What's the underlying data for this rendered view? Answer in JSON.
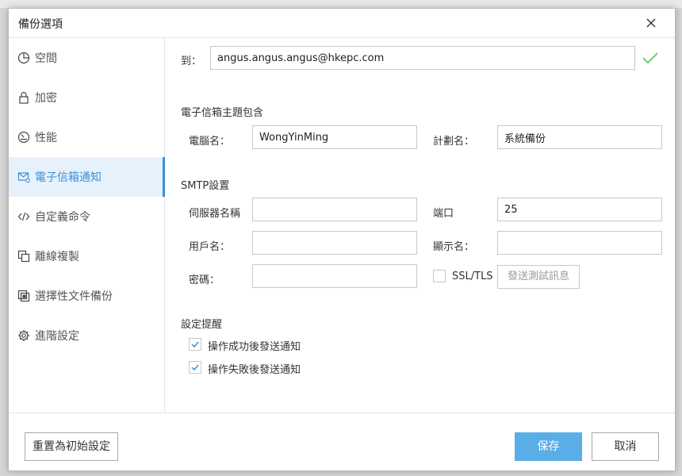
{
  "window": {
    "title": "備份選項",
    "close_icon": "close-icon"
  },
  "sidebar": {
    "items": [
      {
        "label": "空間",
        "icon": "pie-chart-icon"
      },
      {
        "label": "加密",
        "icon": "lock-icon"
      },
      {
        "label": "性能",
        "icon": "gauge-icon"
      },
      {
        "label": "電子信箱通知",
        "icon": "mail-icon",
        "active": true
      },
      {
        "label": "自定義命令",
        "icon": "code-icon"
      },
      {
        "label": "離線複製",
        "icon": "copy-icon"
      },
      {
        "label": "選擇性文件備份",
        "icon": "file-select-icon"
      },
      {
        "label": "進階設定",
        "icon": "gear-icon"
      }
    ]
  },
  "form": {
    "to_label": "到：",
    "to_value": "angus.angus.angus@hkepc.com",
    "subject_section": "電子信箱主題包含",
    "computer_name_label": "電腦名：",
    "computer_name_value": "WongYinMing",
    "plan_name_label": "計劃名：",
    "plan_name_value": "系統備份",
    "smtp_section": "SMTP設置",
    "server_label": "伺服器名稱",
    "server_value": "",
    "port_label": "端口",
    "port_value": "25",
    "username_label": "用戶名：",
    "username_value": "",
    "display_name_label": "顯示名：",
    "display_name_value": "",
    "password_label": "密碼：",
    "password_value": "",
    "ssl_label": "SSL/TLS",
    "ssl_checked": false,
    "test_button": "發送測試訊息",
    "reminder_section": "設定提醒",
    "notify_success_label": "操作成功後發送通知",
    "notify_success_checked": true,
    "notify_fail_label": "操作失敗後發送通知",
    "notify_fail_checked": true
  },
  "footer": {
    "reset_label": "重置為初始設定",
    "save_label": "保存",
    "cancel_label": "取消"
  },
  "colors": {
    "accent": "#3a8fd9",
    "active_bg": "#e6f1fb",
    "save_button": "#5aaee8",
    "success_check": "#6fcf6f"
  }
}
